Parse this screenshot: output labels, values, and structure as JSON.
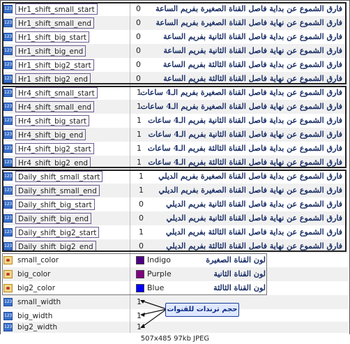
{
  "hr1": [
    {
      "name": "Hr1_shift_small_start",
      "value": "0",
      "note": "فارق الشموع عن بداية فاصل القناة الصغيرة بفريم الساعة"
    },
    {
      "name": "Hr1_shift_small_end",
      "value": "0",
      "note": "فارق الشموع عن نهاية فاصل القناة الصغيرة بفريم الساعة"
    },
    {
      "name": "Hr1_shift_big_start",
      "value": "0",
      "note": "فارق الشموع عن بداية فاصل القناة الثانية بفريم الساعة"
    },
    {
      "name": "Hr1_shift_big_end",
      "value": "0",
      "note": "فارق الشموع عن نهاية فاصل القناة الثانية بفريم الساعة"
    },
    {
      "name": "Hr1_shift_big2_start",
      "value": "0",
      "note": "فارق الشموع عن بداية فاصل القناة الثالثة بفريم الساعة"
    },
    {
      "name": "Hr1_shift_big2_end",
      "value": "0",
      "note": "فارق الشموع عن نهاية فاصل القناة الثالثة بفريم الساعة"
    }
  ],
  "hr4": [
    {
      "name": "Hr4_shift_small_start",
      "value": "1",
      "note": "فارق الشموع عن بداية فاصل القناة الصغيرة بفريم الـ4 ساعات"
    },
    {
      "name": "Hr4_shift_small_end",
      "value": "1",
      "note": "فارق الشموع عن نهاية فاصل القناة الصغيرة بفريم الـ4 ساعات"
    },
    {
      "name": "Hr4_shift_big_start",
      "value": "1",
      "note": "فارق الشموع عن بداية فاصل القناة الثانية بفريم الـ4 ساعات"
    },
    {
      "name": "Hr4_shift_big_end",
      "value": "1",
      "note": "فارق الشموع عن نهاية فاصل القناة الثانية بفريم الـ4 ساعات"
    },
    {
      "name": "Hr4_shift_big2_start",
      "value": "1",
      "note": "فارق الشموع عن بداية فاصل القناة الثالثة بفريم الـ4 ساعات"
    },
    {
      "name": "Hr4_shift_big2_end",
      "value": "1",
      "note": "فارق الشموع عن نهاية فاصل القناة الثالثة بفريم الـ4 ساعات"
    }
  ],
  "daily": [
    {
      "name": "Daily_shift_small_start",
      "value": "1",
      "note": "فارق الشموع عن بداية فاصل القناة الصغيرة بفريم الديلي"
    },
    {
      "name": "Daily_shift_small_end",
      "value": "1",
      "note": "فارق الشموع عن نهاية فاصل القناة الصغيرة بفريم الديلي"
    },
    {
      "name": "Daily_shift_big_start",
      "value": "0",
      "note": "فارق الشموع عن بداية فاصل القناة الثانية بفريم الديلي"
    },
    {
      "name": "Daily_shift_big_end",
      "value": "0",
      "note": "فارق الشموع عن نهاية فاصل القناة الثانية بفريم الديلي"
    },
    {
      "name": "Daily_shift_big2_start",
      "value": "1",
      "note": "فارق الشموع عن بداية فاصل القناة الثالثة بفريم الديلي"
    },
    {
      "name": "Daily_shift_big2_end",
      "value": "0",
      "note": "فارق الشموع عن نهاية فاصل القناة الثالثة بفريم الديلي"
    }
  ],
  "colors": [
    {
      "name": "small_color",
      "value": "Indigo",
      "swatch": "#4b0082",
      "note": "لون القناة الصغيرة"
    },
    {
      "name": "big_color",
      "value": "Purple",
      "swatch": "#800080",
      "note": "لون القناة الثانية"
    },
    {
      "name": "big2_color",
      "value": "Blue",
      "swatch": "#0000ff",
      "note": "لون القناة الثالثة"
    }
  ],
  "widths": [
    {
      "name": "small_width",
      "value": "1"
    },
    {
      "name": "big_width",
      "value": "1"
    },
    {
      "name": "big2_width",
      "value": "1"
    }
  ],
  "callout": "حجم ترندات للقنوات",
  "footer": "507x485  97kb  JPEG"
}
